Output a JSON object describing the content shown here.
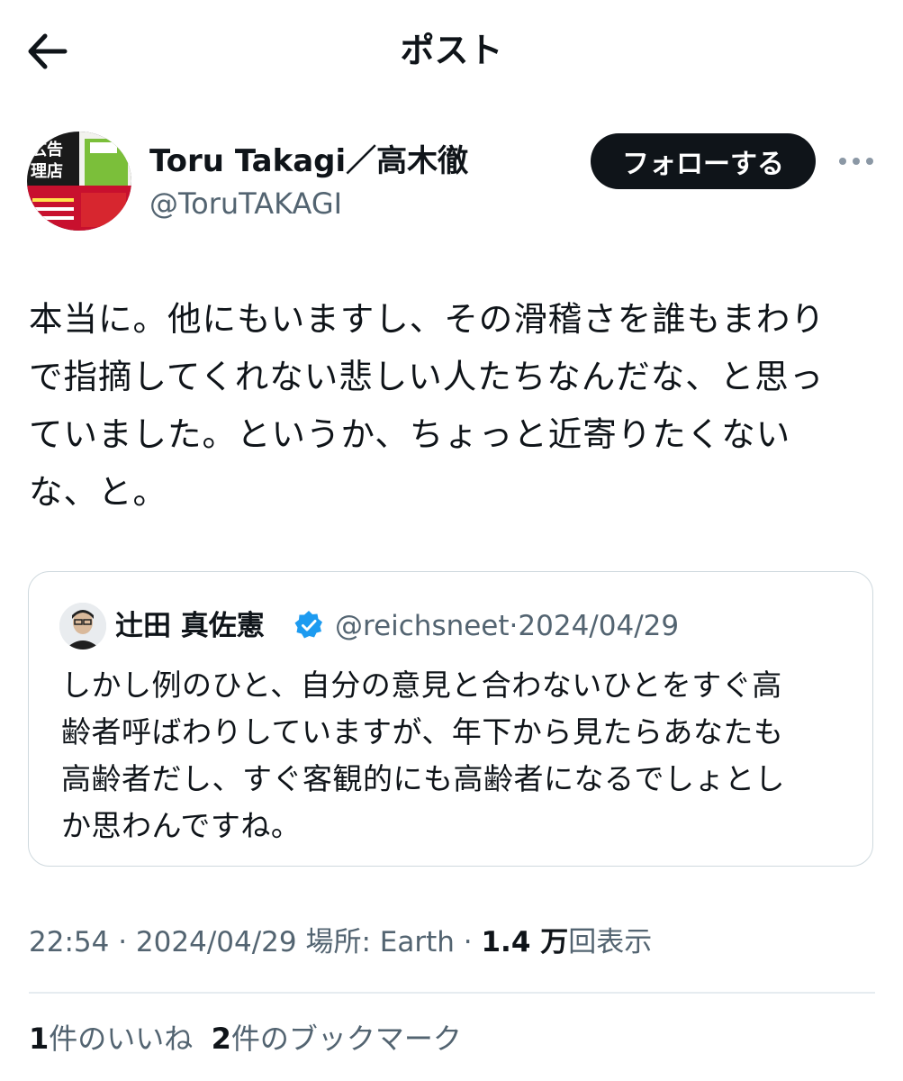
{
  "header": {
    "title": "ポスト",
    "back_icon": "arrow-left-icon"
  },
  "author": {
    "name": "Toru Takagi／高木徹",
    "handle": "@ToruTAKAGI",
    "follow_label": "フォローする",
    "more_icon": "ellipsis-icon",
    "avatar_texts": [
      "広告",
      "理店"
    ]
  },
  "post": {
    "lines": [
      "本当に。他にもいますし、その滑稽さを誰もまわり",
      "で指摘してくれない悲しい人たちなんだな、と思っ",
      "ていました。というか、ちょっと近寄りたくない",
      "な、と。"
    ]
  },
  "quote": {
    "name": "辻田 真佐憲",
    "verified_icon": "verified-badge-icon",
    "handle": "@reichsneet",
    "separator": "·",
    "date": "2024/04/29",
    "lines": [
      "しかし例のひと、自分の意見と合わないひとをすぐ高",
      "齢者呼ばわりしていますが、年下から見たらあなたも",
      "高齢者だし、すぐ客観的にも高齢者になるでしょとし",
      "か思わんですね。"
    ]
  },
  "meta": {
    "time": "22:54",
    "sep": "·",
    "date": "2024/04/29",
    "location_label": "場所: Earth",
    "views_count": "1.4 万",
    "views_label": "回表示"
  },
  "stats": {
    "likes_count": "1",
    "likes_label": "件のいいね",
    "bookmarks_count": "2",
    "bookmarks_label": "件のブックマーク"
  },
  "colors": {
    "text": "#0f1419",
    "secondary": "#536471",
    "verified": "#1d9bf0",
    "border": "#cfd9de"
  }
}
